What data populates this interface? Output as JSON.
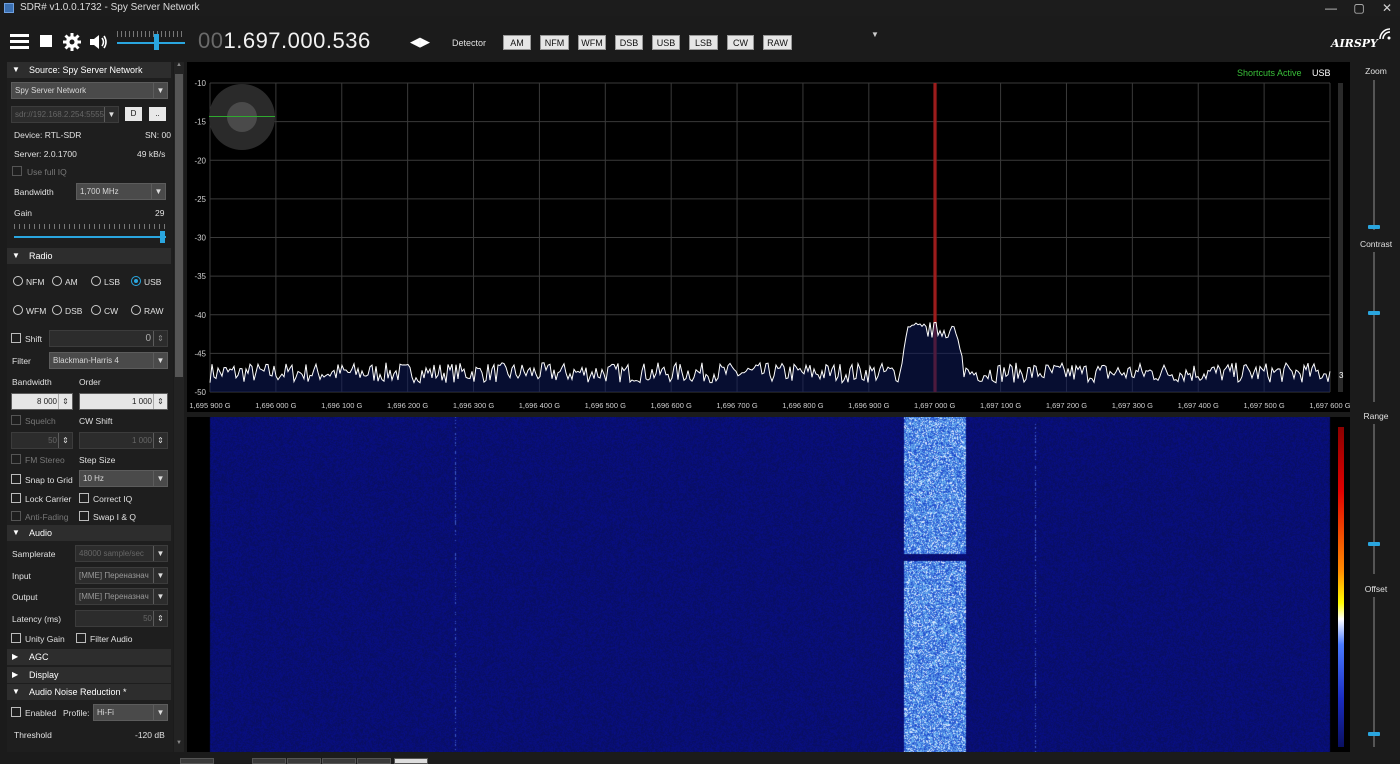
{
  "window": {
    "title": "SDR# v1.0.0.1732 - Spy Server Network"
  },
  "toolbar": {
    "freq_dim": "00",
    "freq_main": "1.697.000.536",
    "detector_label": "Detector",
    "modes": [
      "AM",
      "NFM",
      "WFM",
      "DSB",
      "USB",
      "LSB",
      "CW",
      "RAW"
    ],
    "logo": "AIRSPY",
    "volume_level": 0.58
  },
  "source": {
    "header": "Source: Spy Server Network",
    "device_type": "Spy Server Network",
    "url": "sdr://192.168.2.254:5555",
    "btn_d": "D",
    "btn_more": "..",
    "device_label": "Device: RTL-SDR",
    "sn_label": "SN: 00",
    "server_label": "Server: 2.0.1700",
    "rate_label": "49 kB/s",
    "full_iq_label": "Use full IQ",
    "bandwidth_label": "Bandwidth",
    "bandwidth_value": "1,700 MHz",
    "gain_label": "Gain",
    "gain_value": "29",
    "gain_level": 1.0
  },
  "radio": {
    "header": "Radio",
    "modes_row1": [
      "NFM",
      "AM",
      "LSB",
      "USB"
    ],
    "modes_row2": [
      "WFM",
      "DSB",
      "CW",
      "RAW"
    ],
    "selected_mode": "USB",
    "shift_label": "Shift",
    "shift_value": "0",
    "filter_label": "Filter",
    "filter_value": "Blackman-Harris 4",
    "bandwidth_label": "Bandwidth",
    "order_label": "Order",
    "bandwidth_value": "8 000",
    "order_value": "1 000",
    "squelch_label": "Squelch",
    "cw_shift_label": "CW Shift",
    "squelch_value": "50",
    "cw_shift_value": "1 000",
    "fm_stereo_label": "FM Stereo",
    "step_size_label": "Step Size",
    "snap_label": "Snap to Grid",
    "step_value": "10 Hz",
    "lock_carrier_label": "Lock Carrier",
    "correct_iq_label": "Correct IQ",
    "anti_fading_label": "Anti-Fading",
    "swap_iq_label": "Swap I & Q"
  },
  "audio": {
    "header": "Audio",
    "samplerate_label": "Samplerate",
    "samplerate_value": "48000 sample/sec",
    "input_label": "Input",
    "input_value": "[MME] Переназнач",
    "output_label": "Output",
    "output_value": "[MME] Переназнач",
    "latency_label": "Latency (ms)",
    "latency_value": "50",
    "unity_gain_label": "Unity Gain",
    "filter_audio_label": "Filter Audio"
  },
  "collapsed": {
    "agc": "AGC",
    "display": "Display"
  },
  "noise_reduction": {
    "header": "Audio Noise Reduction *",
    "enabled_label": "Enabled",
    "profile_label": "Profile:",
    "profile_value": "Hi-Fi",
    "threshold_label": "Threshold",
    "threshold_value": "-120 dB"
  },
  "spectrum": {
    "shortcuts_label": "Shortcuts Active",
    "mode_label": "USB",
    "y_ticks": [
      "-10",
      "-15",
      "-20",
      "-25",
      "-30",
      "-35",
      "-40",
      "-45",
      "-50"
    ],
    "x_ticks": [
      "1,695 900 G",
      "1,696 000 G",
      "1,696 100 G",
      "1,696 200 G",
      "1,696 300 G",
      "1,696 400 G",
      "1,696 500 G",
      "1,696 600 G",
      "1,696 700 G",
      "1,696 800 G",
      "1,696 900 G",
      "1,697 000 G",
      "1,697 100 G",
      "1,697 200 G",
      "1,697 300 G",
      "1,697 400 G",
      "1,697 500 G",
      "1,697 600 G"
    ],
    "scale_marker": "3",
    "noise_floor_db": -47.5,
    "signal_db": -42,
    "center_freq_ghz": 1.697000536
  },
  "right": {
    "zoom_label": "Zoom",
    "contrast_label": "Contrast",
    "range_label": "Range",
    "offset_label": "Offset"
  },
  "colors": {
    "accent": "#2aa6df",
    "shortcuts": "#39c039",
    "waterfall_bg": "#0b1170"
  }
}
